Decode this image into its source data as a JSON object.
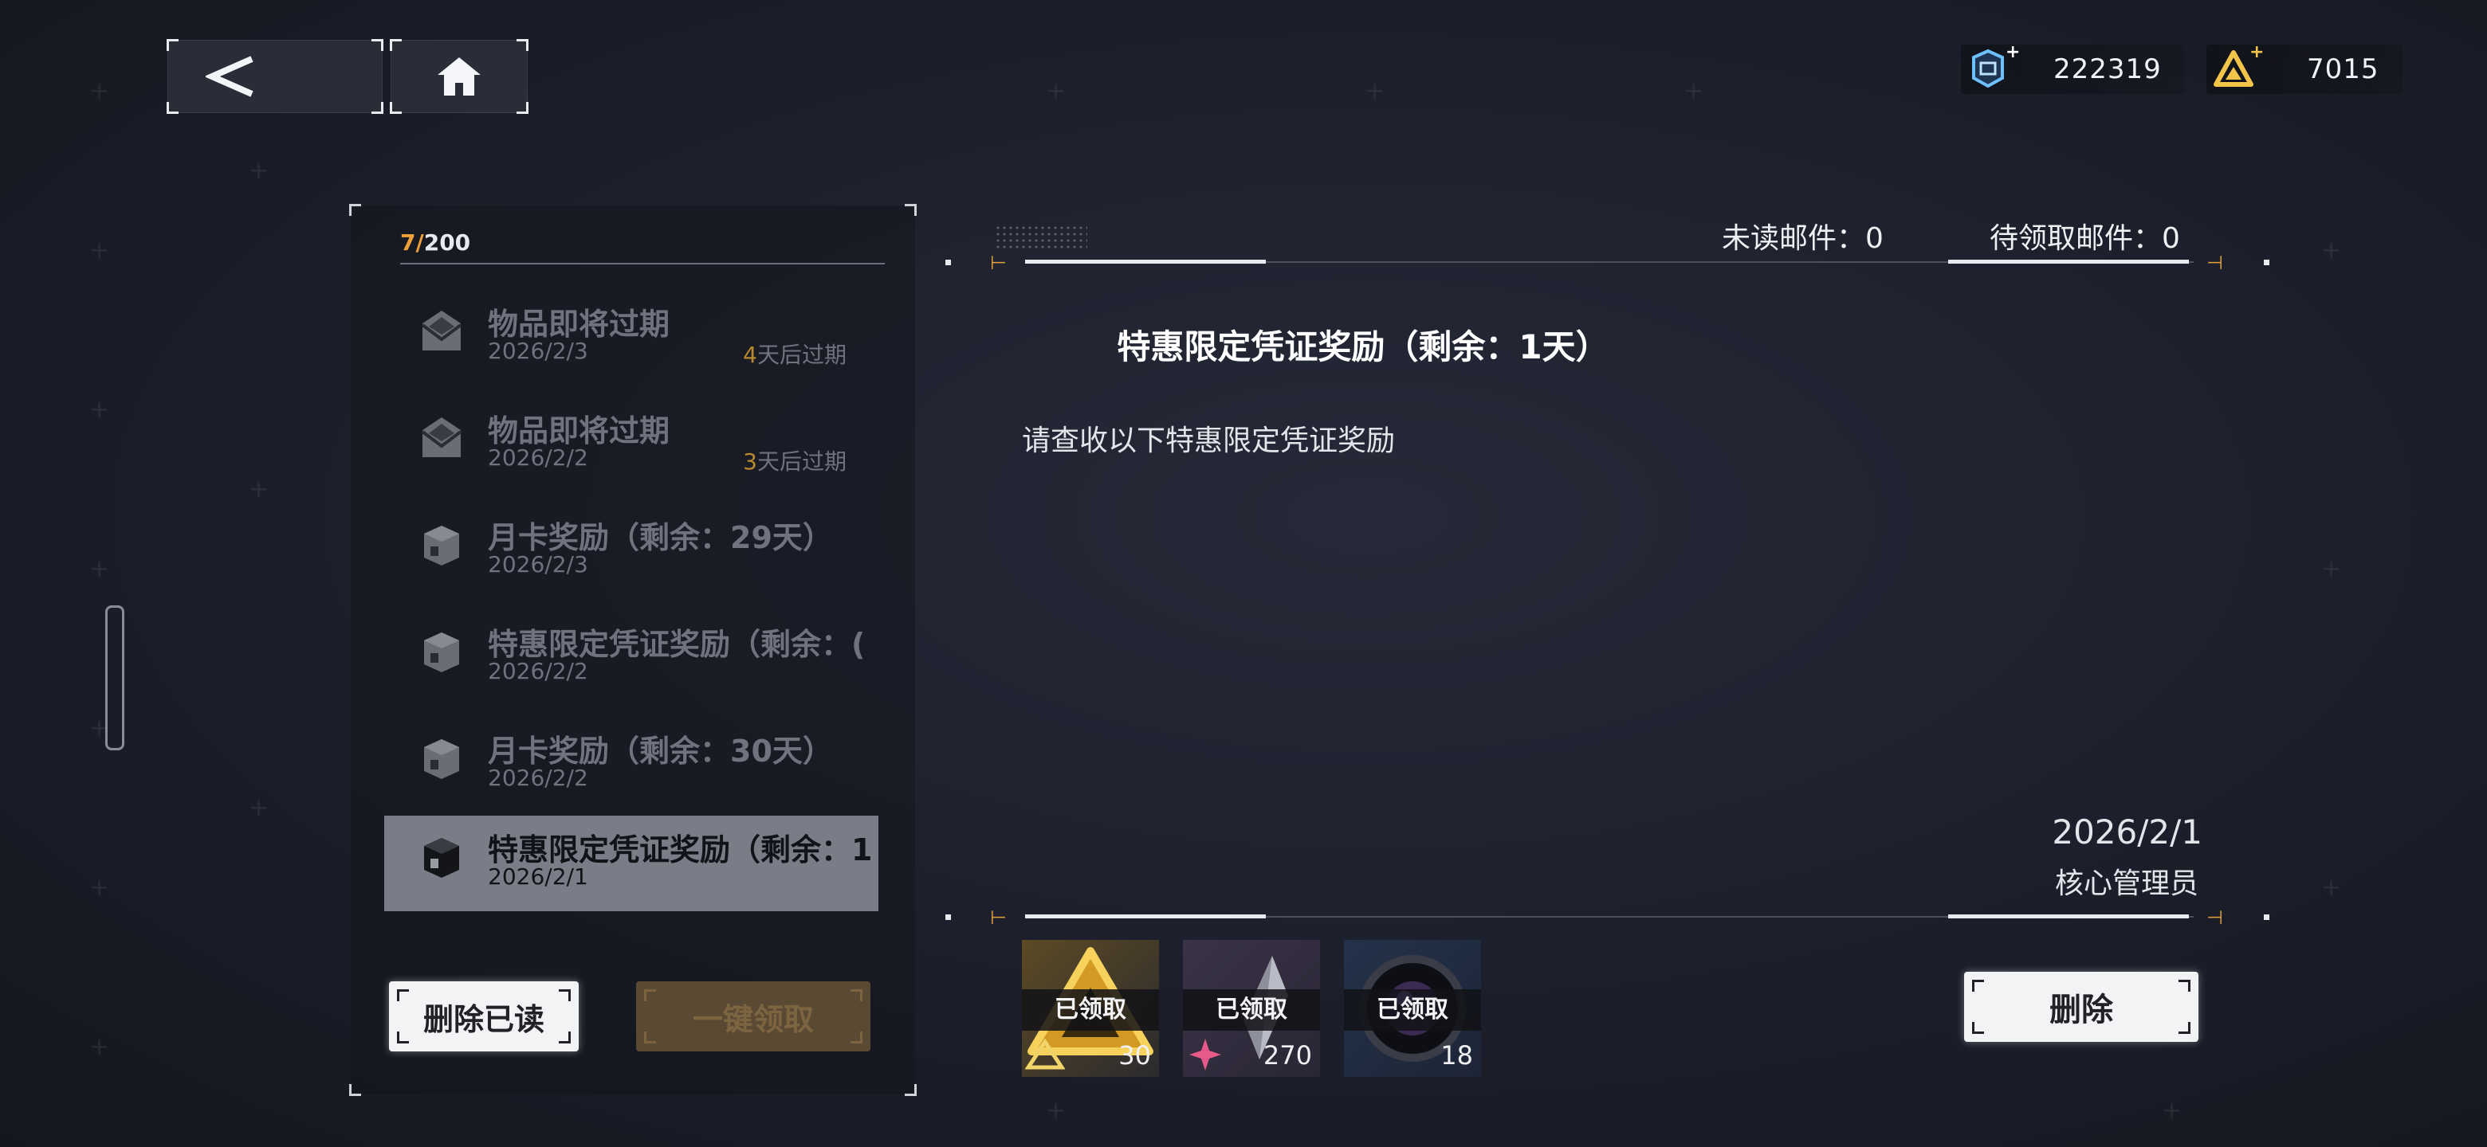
{
  "topbar": {
    "back_icon": "back-arrow-icon",
    "home_icon": "home-icon",
    "currencies": [
      {
        "icon": "credit-chip-icon",
        "value": "222319",
        "color": "#5fb0ff"
      },
      {
        "icon": "triangle-gem-icon",
        "value": "7015",
        "color": "#f3c44a"
      }
    ]
  },
  "mailbox": {
    "count_current": "7",
    "count_sep": "/",
    "count_max": "200",
    "items": [
      {
        "icon": "envelope-icon",
        "title": "物品即将过期",
        "date": "2026/2/3",
        "expire_num": "4",
        "expire_text": "天后过期"
      },
      {
        "icon": "envelope-icon",
        "title": "物品即将过期",
        "date": "2026/2/2",
        "expire_num": "3",
        "expire_text": "天后过期"
      },
      {
        "icon": "package-icon",
        "title": "月卡奖励（剩余：29天）",
        "date": "2026/2/3"
      },
      {
        "icon": "package-icon",
        "title": "特惠限定凭证奖励（剩余：(",
        "date": "2026/2/2"
      },
      {
        "icon": "package-icon",
        "title": "月卡奖励（剩余：30天）",
        "date": "2026/2/2"
      },
      {
        "icon": "package-icon",
        "title": "特惠限定凭证奖励（剩余：1",
        "date": "2026/2/1"
      }
    ],
    "delete_read_label": "删除已读",
    "claim_all_label": "一键领取"
  },
  "detail": {
    "unread_label": "未读邮件：0",
    "pending_label": "待领取邮件：0",
    "title": "特惠限定凭证奖励（剩余：1天）",
    "body": "请查收以下特惠限定凭证奖励",
    "date": "2026/2/1",
    "sender": "核心管理员",
    "rewards": [
      {
        "icon": "gold-triangle-item-icon",
        "status": "已领取",
        "qty": "30"
      },
      {
        "icon": "crystal-shard-item-icon",
        "status": "已领取",
        "qty": "270"
      },
      {
        "icon": "lens-item-icon",
        "status": "已领取",
        "qty": "18"
      }
    ],
    "delete_label": "删除"
  }
}
